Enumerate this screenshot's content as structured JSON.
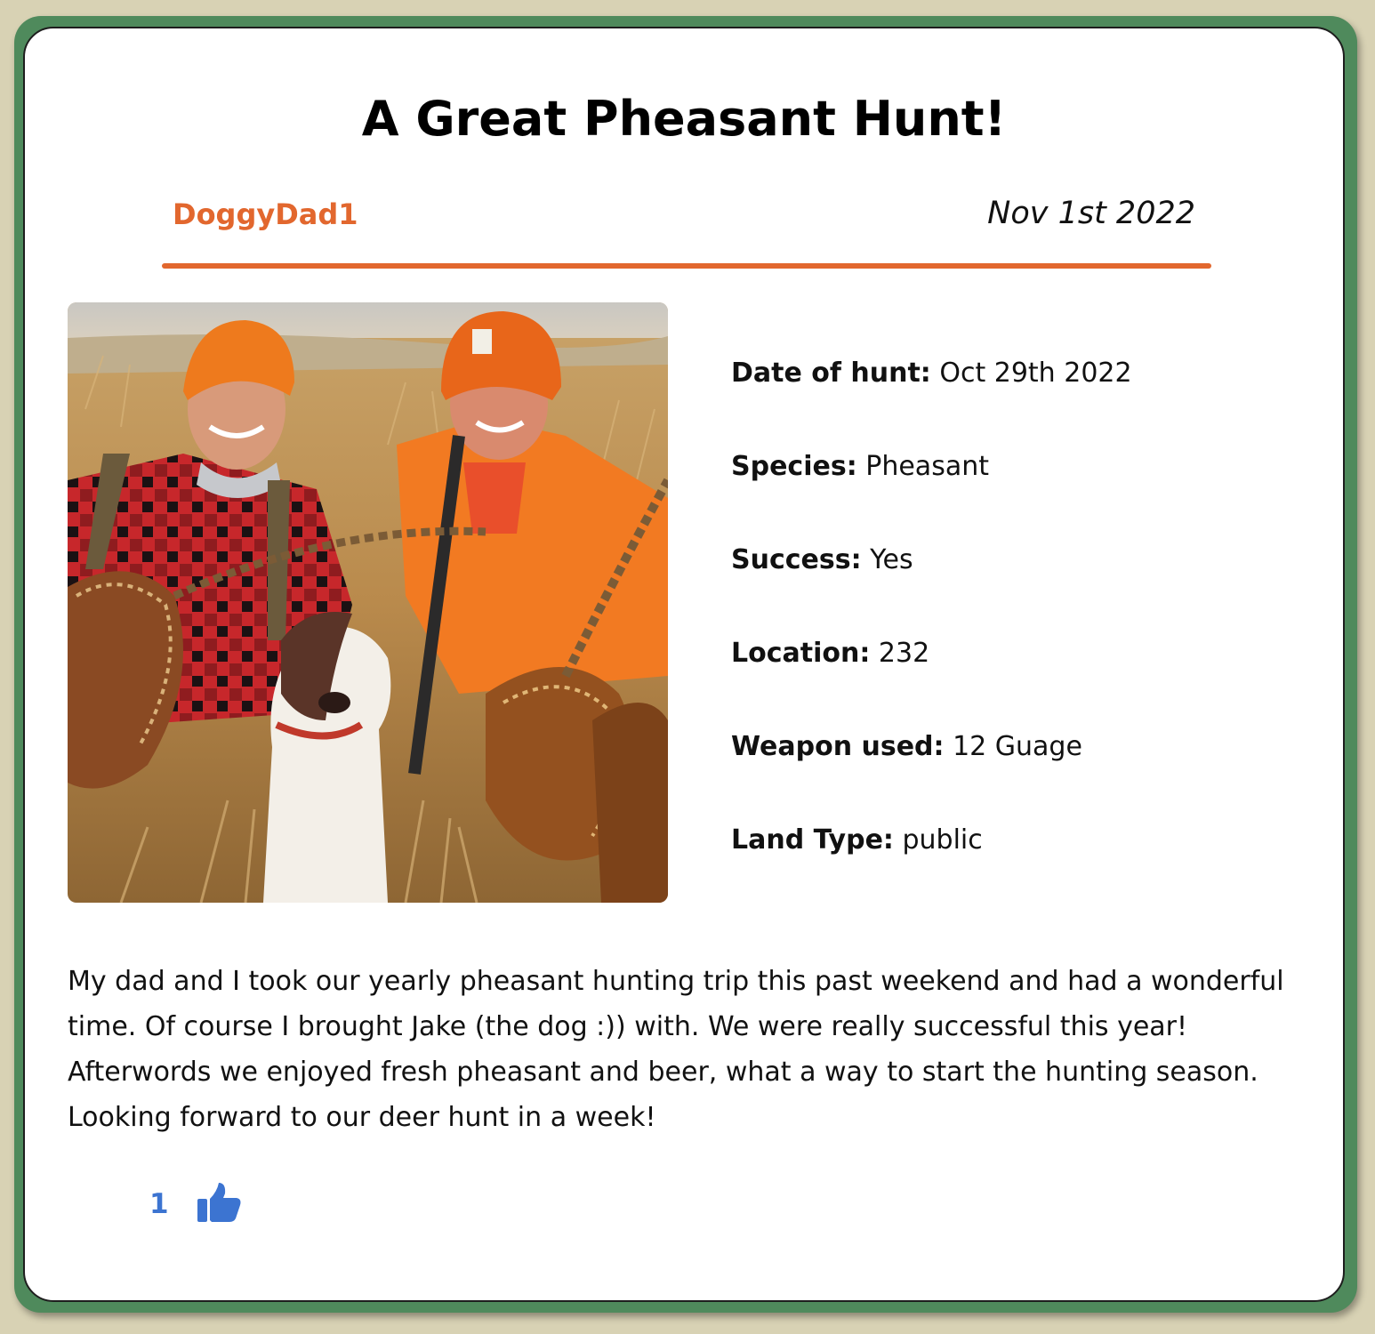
{
  "post": {
    "title": "A Great Pheasant Hunt!",
    "author": "DoggyDad1",
    "posted_date": "Nov 1st 2022",
    "accent_color": "#e2672e",
    "photo_icon": "hunt-photo",
    "details": [
      {
        "label": "Date of hunt:",
        "value": "Oct 29th 2022"
      },
      {
        "label": "Species:",
        "value": "Pheasant"
      },
      {
        "label": "Success:",
        "value": "Yes"
      },
      {
        "label": "Location:",
        "value": "232"
      },
      {
        "label": "Weapon used:",
        "value": "12 Guage"
      },
      {
        "label": "Land Type:",
        "value": "public"
      }
    ],
    "body_lines": [
      "My dad and I took our yearly pheasant hunting trip this past weekend and had a wonderful",
      "time. Of course I brought Jake (the dog :)) with. We were really successful this year!",
      "Afterwords we enjoyed fresh pheasant and beer, what a way to start the hunting season.",
      "Looking forward to our deer hunt in a week!"
    ],
    "likes": {
      "count": "1",
      "icon": "thumbs-up-icon",
      "color": "#3c74d1"
    }
  },
  "theme": {
    "page_bg": "#d8d2b4",
    "frame_color": "#4f8a5c",
    "card_bg": "#ffffff"
  }
}
